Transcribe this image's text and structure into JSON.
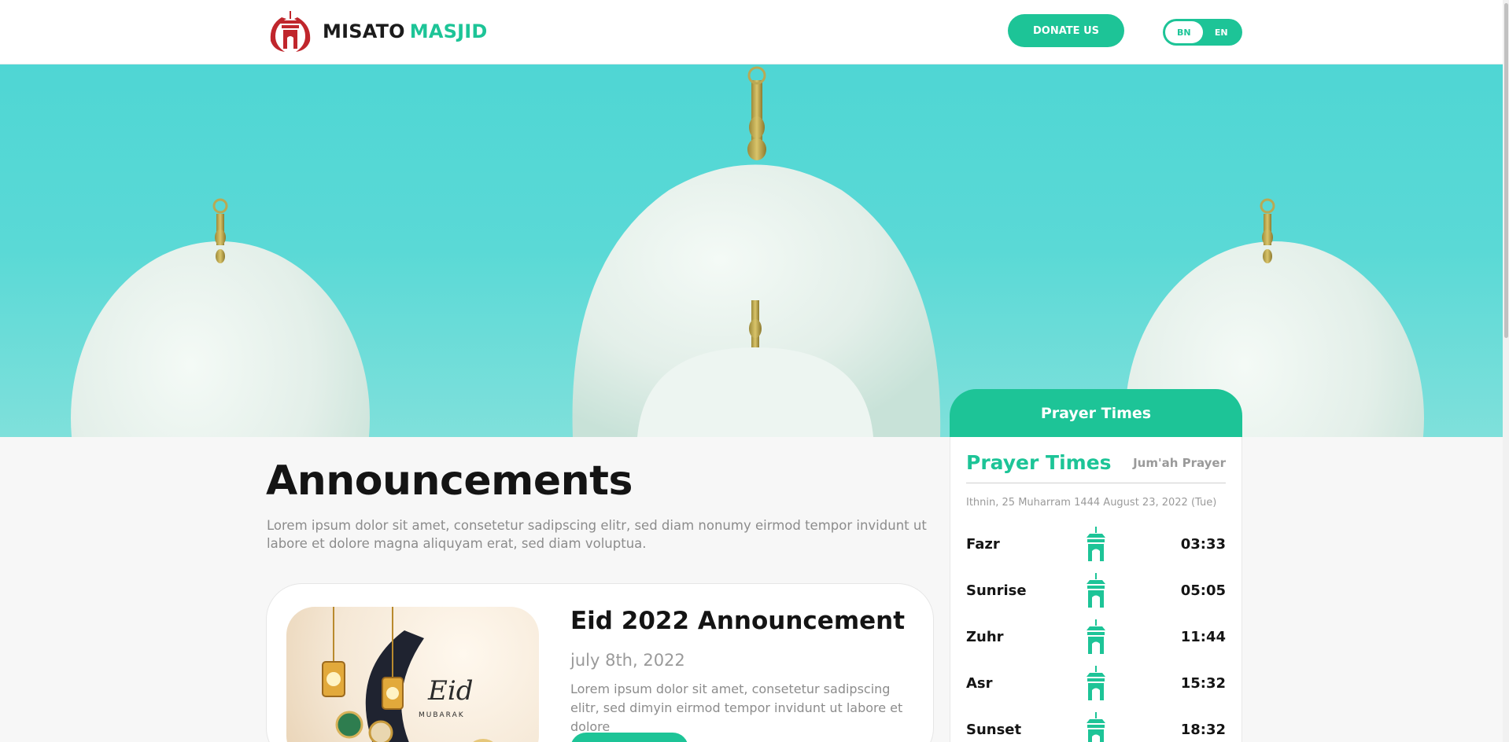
{
  "brand": {
    "name_part1": "MISATO",
    "name_part2": "MASJID",
    "primary_color": "#1dc497",
    "logo_color": "#c0262c"
  },
  "header": {
    "donate_label": "DONATE US",
    "languages": [
      {
        "code": "BN",
        "active": true
      },
      {
        "code": "EN",
        "active": false
      }
    ]
  },
  "announcements": {
    "title": "Announcements",
    "description": "Lorem ipsum dolor sit amet, consetetur sadipscing elitr, sed diam nonumy eirmod tempor invidunt ut labore et dolore magna aliquyam erat, sed diam voluptua.",
    "items": [
      {
        "title": "Eid 2022 Announcement",
        "date": "july 8th, 2022",
        "text": "Lorem ipsum dolor sit amet, consetetur sadipscing elitr, sed dimyin eirmod tempor invidunt ut labore et dolore",
        "image_text_1": "Eid",
        "image_text_2": "MUBARAK"
      }
    ]
  },
  "prayer": {
    "header_label": "Prayer Times",
    "title": "Prayer Times",
    "jumah_label": "Jum'ah Prayer",
    "date_line": "Ithnin, 25 Muharram 1444 August 23, 2022 (Tue)",
    "icon": "mosque-icon",
    "times": [
      {
        "name": "Fazr",
        "time": "03:33"
      },
      {
        "name": "Sunrise",
        "time": "05:05"
      },
      {
        "name": "Zuhr",
        "time": "11:44"
      },
      {
        "name": "Asr",
        "time": "15:32"
      },
      {
        "name": "Sunset",
        "time": "18:32"
      }
    ]
  }
}
